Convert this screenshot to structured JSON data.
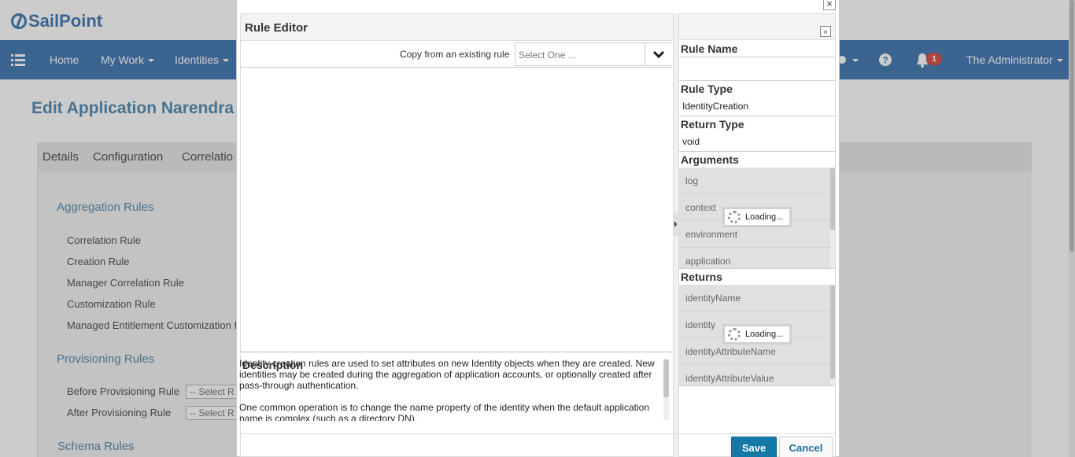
{
  "app": {
    "logo_text": "SailPoint",
    "nav": {
      "home": "Home",
      "my_work": "My Work",
      "identities": "Identities",
      "notification_count": "1",
      "user": "The Administrator"
    }
  },
  "page": {
    "title": "Edit Application Narendra",
    "tabs": [
      "Details",
      "Configuration",
      "Correlatio"
    ],
    "sections": {
      "aggregation": {
        "heading": "Aggregation Rules",
        "rules": [
          "Correlation Rule",
          "Creation Rule",
          "Manager Correlation Rule",
          "Customization Rule",
          "Managed Entitlement Customization R"
        ]
      },
      "provisioning": {
        "heading": "Provisioning Rules",
        "rules": [
          "Before Provisioning Rule",
          "After Provisioning Rule"
        ],
        "select_text": "-- Select R"
      },
      "schema": {
        "heading": "Schema Rules"
      }
    }
  },
  "modal": {
    "close_label": "×",
    "editor": {
      "title": "Rule Editor",
      "copy_label": "Copy from an existing rule",
      "copy_placeholder": "Select One ...",
      "description_label": "Description",
      "description_p1": "Identity creation rules are used to set attributes on new Identity objects when they are created.  New identities may be created during the aggregation of application accounts, or optionally created after pass-through authentication.",
      "description_p2": "One common operation is to change the name property of the identity when the default application name is complex (such as a directory DN)."
    },
    "side": {
      "expand_label": "»",
      "rule_name_label": "Rule Name",
      "rule_name_value": "",
      "rule_type_label": "Rule Type",
      "rule_type_value": "IdentityCreation",
      "return_type_label": "Return Type",
      "return_type_value": "void",
      "arguments_label": "Arguments",
      "arguments": [
        "log",
        "context",
        "environment",
        "application"
      ],
      "returns_label": "Returns",
      "returns": [
        "identityName",
        "identity",
        "identityAttributeName",
        "identityAttributeValue"
      ],
      "loading_text": "Loading..."
    },
    "buttons": {
      "save": "Save",
      "cancel": "Cancel"
    }
  }
}
